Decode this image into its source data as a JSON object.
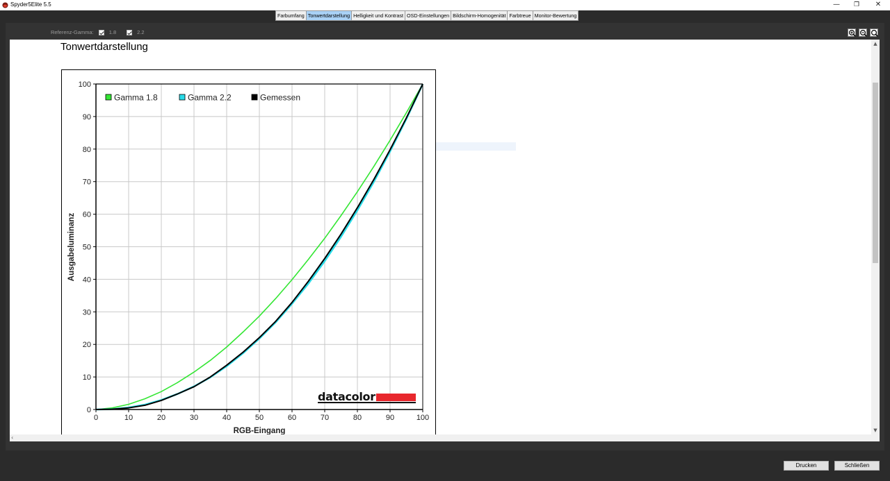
{
  "window": {
    "title": "Spyder5Elite 5.5",
    "controls": {
      "minimize": "—",
      "maximize": "❐",
      "close": "✕"
    }
  },
  "tabs": [
    {
      "label": "Farbumfang",
      "active": false
    },
    {
      "label": "Tonwertdarstellung",
      "active": true
    },
    {
      "label": "Helligkeit und Kontrast",
      "active": false
    },
    {
      "label": "OSD-Einstellungen",
      "active": false
    },
    {
      "label": "Bildschirm-Homogenität",
      "active": false
    },
    {
      "label": "Farbtreue",
      "active": false
    },
    {
      "label": "Monitor-Bewertung",
      "active": false
    }
  ],
  "reference_gamma": {
    "label": "Referenz-Gamma:",
    "options": [
      {
        "label": "1.8",
        "checked": true
      },
      {
        "label": "2.2",
        "checked": true
      }
    ]
  },
  "zoom_icons": [
    "zoom-in-icon",
    "zoom-out-icon",
    "zoom-fit-icon"
  ],
  "page_title": "Tonwertdarstellung",
  "logo_text": "datacolor",
  "chart_data": {
    "type": "line",
    "title": "",
    "xlabel": "RGB-Eingang",
    "ylabel": "Ausgabeluminanz",
    "xlim": [
      0,
      100
    ],
    "ylim": [
      0,
      100
    ],
    "xticks": [
      0,
      10,
      20,
      30,
      40,
      50,
      60,
      70,
      80,
      90,
      100
    ],
    "yticks": [
      0,
      10,
      20,
      30,
      40,
      50,
      60,
      70,
      80,
      90,
      100
    ],
    "grid": true,
    "legend": "top-left",
    "series": [
      {
        "name": "Gamma 1.8",
        "color": "#33e633",
        "x": [
          0,
          5,
          10,
          15,
          20,
          25,
          30,
          35,
          40,
          45,
          50,
          55,
          60,
          65,
          70,
          75,
          80,
          85,
          90,
          95,
          100
        ],
        "y": [
          0,
          0.5,
          1.6,
          3.3,
          5.5,
          8.3,
          11.5,
          15.1,
          19.2,
          23.8,
          28.7,
          34.1,
          39.9,
          46.1,
          52.6,
          59.6,
          66.9,
          74.6,
          82.7,
          91.2,
          100
        ]
      },
      {
        "name": "Gamma 2.2",
        "color": "#29dbe8",
        "x": [
          0,
          5,
          10,
          15,
          20,
          25,
          30,
          35,
          40,
          45,
          50,
          55,
          60,
          65,
          70,
          75,
          80,
          85,
          90,
          95,
          100
        ],
        "y": [
          0,
          0.1,
          0.6,
          1.5,
          2.9,
          4.8,
          7.1,
          9.9,
          13.3,
          17.3,
          21.8,
          26.8,
          32.5,
          38.7,
          45.6,
          53.1,
          61.2,
          69.9,
          79.3,
          89.3,
          100
        ]
      },
      {
        "name": "Gemessen",
        "color": "#000000",
        "x": [
          0,
          5,
          10,
          15,
          20,
          25,
          30,
          35,
          40,
          45,
          50,
          55,
          60,
          65,
          70,
          75,
          80,
          85,
          90,
          95,
          100
        ],
        "y": [
          0,
          0.1,
          0.5,
          1.3,
          2.8,
          4.8,
          7.0,
          10.0,
          13.6,
          17.6,
          22.1,
          27.1,
          32.9,
          39.4,
          46.4,
          53.9,
          62.0,
          70.6,
          79.8,
          89.6,
          100
        ]
      }
    ]
  },
  "buttons": {
    "print": "Drucken",
    "close": "Schließen"
  },
  "colors": {
    "active_tab": "#a9d1f5",
    "logo_bar": "#e8272d"
  }
}
